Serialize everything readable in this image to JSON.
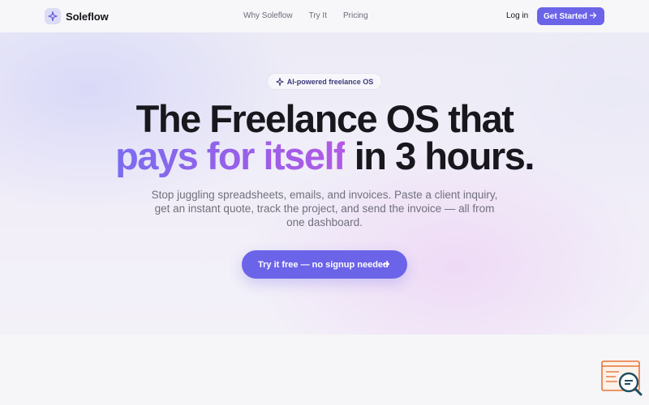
{
  "nav": {
    "brand": "Soleflow",
    "links": [
      "Why Soleflow",
      "Try It",
      "Pricing"
    ],
    "login": "Log in",
    "cta": "Get Started",
    "brand_icon": "sparkle-icon"
  },
  "hero": {
    "badge": "AI-powered freelance OS",
    "headline_line1": "The Freelance OS that",
    "headline_highlight": "pays for itself",
    "headline_rest": " in 3 hours.",
    "subtext": "Stop juggling spreadsheets, emails, and invoices. Paste a client inquiry, get an instant quote, track the project, and send the invoice — all from one dashboard.",
    "cta": "Try it free — no signup needed"
  },
  "colors": {
    "accent": "#6b63e8",
    "gradient_start": "#7b6df0",
    "gradient_end": "#b25ae6",
    "widget": "#e8743b"
  },
  "widget": {
    "icon": "search-chat-icon"
  }
}
